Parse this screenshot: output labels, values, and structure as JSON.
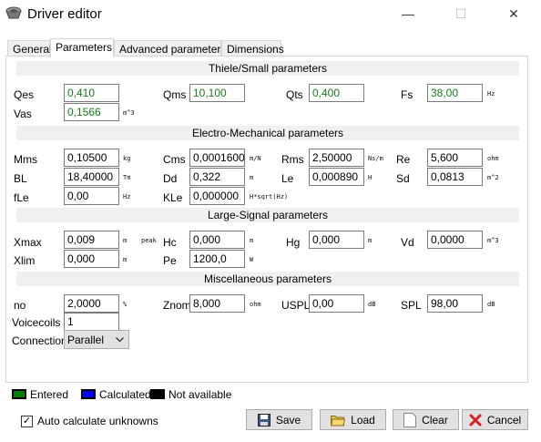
{
  "window": {
    "title": "Driver editor",
    "minimize": "—",
    "maximize": "☐",
    "close": "✕"
  },
  "tabs": [
    "General",
    "Parameters",
    "Advanced parameters",
    "Dimensions"
  ],
  "sections": {
    "ts": "Thiele/Small parameters",
    "em": "Electro-Mechanical parameters",
    "ls": "Large-Signal parameters",
    "misc": "Miscellaneous parameters"
  },
  "ts": {
    "qes": {
      "label": "Qes",
      "value": "0,410"
    },
    "qms": {
      "label": "Qms",
      "value": "10,100"
    },
    "qts": {
      "label": "Qts",
      "value": "0,400"
    },
    "fs": {
      "label": "Fs",
      "value": "38,00",
      "unit": "Hz"
    },
    "vas": {
      "label": "Vas",
      "value": "0,1566",
      "unit": "m^3"
    }
  },
  "em": {
    "mms": {
      "label": "Mms",
      "value": "0,10500",
      "unit": "kg"
    },
    "cms": {
      "label": "Cms",
      "value": "0,0001600",
      "unit": "m/N"
    },
    "rms": {
      "label": "Rms",
      "value": "2,50000",
      "unit": "Ns/m"
    },
    "re": {
      "label": "Re",
      "value": "5,600",
      "unit": "ohm"
    },
    "bl": {
      "label": "BL",
      "value": "18,40000",
      "unit": "Tm"
    },
    "dd": {
      "label": "Dd",
      "value": "0,322",
      "unit": "m"
    },
    "le": {
      "label": "Le",
      "value": "0,000890",
      "unit": "H"
    },
    "sd": {
      "label": "Sd",
      "value": "0,0813",
      "unit": "m^2"
    },
    "fle": {
      "label": "fLe",
      "value": "0,00",
      "unit": "Hz"
    },
    "kle": {
      "label": "KLe",
      "value": "0,000000",
      "unit": "H*sqrt(Hz)"
    }
  },
  "ls": {
    "xmax": {
      "label": "Xmax",
      "value": "0,009",
      "unit": "m",
      "unit2": "peak"
    },
    "hc": {
      "label": "Hc",
      "value": "0,000",
      "unit": "m"
    },
    "hg": {
      "label": "Hg",
      "value": "0,000",
      "unit": "m"
    },
    "vd": {
      "label": "Vd",
      "value": "0,0000",
      "unit": "m^3"
    },
    "xlim": {
      "label": "Xlim",
      "value": "0,000",
      "unit": "m"
    },
    "pe": {
      "label": "Pe",
      "value": "1200,0",
      "unit": "W"
    }
  },
  "misc": {
    "no": {
      "label": "no",
      "value": "2,0000",
      "unit": "%"
    },
    "znom": {
      "label": "Znom",
      "value": "8,000",
      "unit": "ohm"
    },
    "uspl": {
      "label": "USPL",
      "value": "0,00",
      "unit": "dB"
    },
    "spl": {
      "label": "SPL",
      "value": "98,00",
      "unit": "dB"
    },
    "voicecoils": {
      "label": "Voicecoils",
      "value": "1"
    },
    "connection": {
      "label": "Connection",
      "value": "Parallel"
    }
  },
  "legend": {
    "entered": {
      "label": "Entered",
      "color": "#008000"
    },
    "calculated": {
      "label": "Calculated",
      "color": "#0000ff"
    },
    "not_available": {
      "label": "Not available",
      "color": "#000000"
    }
  },
  "auto_calc": {
    "label": "Auto calculate unknowns",
    "checked": true
  },
  "buttons": {
    "save": "Save",
    "load": "Load",
    "clear": "Clear",
    "cancel": "Cancel"
  }
}
